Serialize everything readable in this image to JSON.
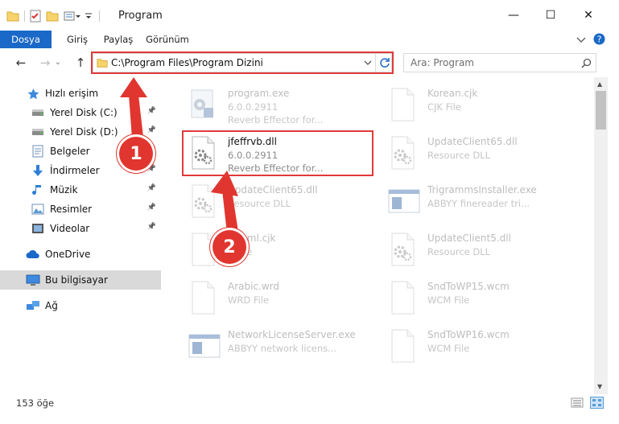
{
  "window": {
    "title": "Program",
    "min": "—",
    "max": "☐",
    "close": "✕"
  },
  "ribbon": {
    "tabs": [
      "Dosya",
      "Giriş",
      "Paylaş",
      "Görünüm"
    ]
  },
  "navigation": {
    "address": "C:\\Program Files\\Program Dizini",
    "search_placeholder": "Ara: Program"
  },
  "sidebar": {
    "items": [
      {
        "label": "Hızlı erişim",
        "icon": "star-icon"
      },
      {
        "label": "Yerel Disk (C:)",
        "icon": "drive-icon",
        "pinned": true
      },
      {
        "label": "Yerel Disk (D:)",
        "icon": "drive-icon",
        "pinned": true
      },
      {
        "label": "Belgeler",
        "icon": "documents-icon",
        "pinned": true
      },
      {
        "label": "İndirmeler",
        "icon": "download-icon",
        "pinned": true
      },
      {
        "label": "Müzik",
        "icon": "music-icon",
        "pinned": true
      },
      {
        "label": "Resimler",
        "icon": "pictures-icon",
        "pinned": true
      },
      {
        "label": "Videolar",
        "icon": "videos-icon",
        "pinned": true
      },
      {
        "label": "OneDrive",
        "icon": "cloud-icon"
      },
      {
        "label": "Bu bilgisayar",
        "icon": "computer-icon",
        "selected": true
      },
      {
        "label": "Ağ",
        "icon": "network-icon"
      }
    ]
  },
  "files": [
    {
      "name": "program.exe",
      "ver": "6.0.0.2911",
      "desc": "Reverb Effector for...",
      "type": "exe"
    },
    {
      "name": "Korean.cjk",
      "ver": "CJK File",
      "desc": "",
      "type": "blank"
    },
    {
      "name": "jfeffrvb.dll",
      "ver": "6.0.0.2911",
      "desc": "Reverb Effector for...",
      "type": "dll",
      "highlight": true
    },
    {
      "name": "UpdateClient65.dll",
      "ver": "Resource DLL",
      "desc": "",
      "type": "dll"
    },
    {
      "name": "UpdateClient65.dll",
      "ver": "Resource DLL",
      "desc": "",
      "type": "dll"
    },
    {
      "name": "TrigrammsInstaller.exe",
      "ver": "ABBYY finereader tri...",
      "desc": "",
      "type": "app"
    },
    {
      "name": "...html.cjk",
      "ver": "...File",
      "desc": "",
      "type": "blank"
    },
    {
      "name": "UpdateClient5.dll",
      "ver": "Resource DLL",
      "desc": "",
      "type": "dll"
    },
    {
      "name": "Arabic.wrd",
      "ver": "WRD File",
      "desc": "",
      "type": "blank"
    },
    {
      "name": "SndToWP15.wcm",
      "ver": "WCM File",
      "desc": "",
      "type": "blank"
    },
    {
      "name": "NetworkLicenseServer.exe",
      "ver": "ABBYY network licens...",
      "desc": "",
      "type": "app"
    },
    {
      "name": "SndToWP16.wcm",
      "ver": "WCM File",
      "desc": "",
      "type": "blank"
    }
  ],
  "status": {
    "count": "153 öğe"
  },
  "annotations": {
    "step1": "1",
    "step2": "2",
    "color": "#e0362f"
  }
}
